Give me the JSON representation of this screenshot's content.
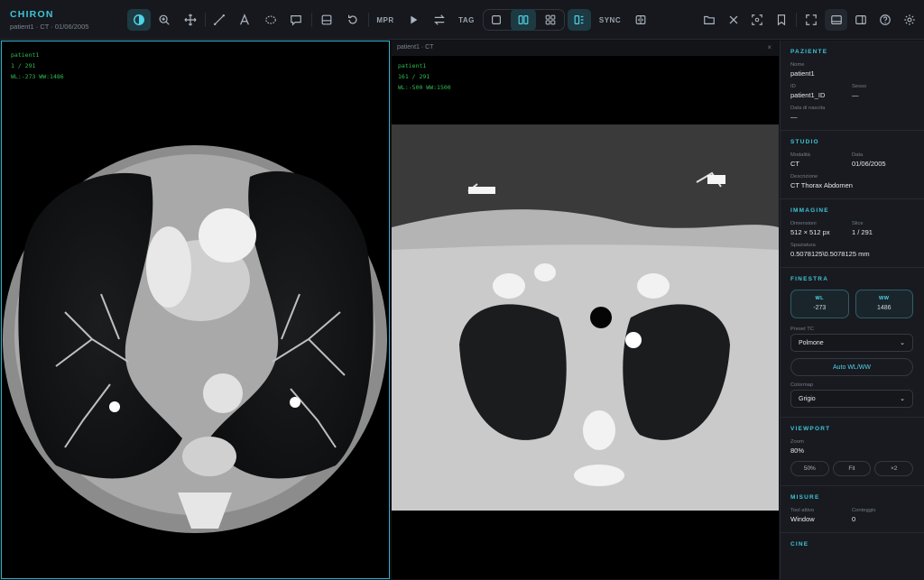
{
  "app": {
    "title": "CHIRON",
    "subtitle": "patient1 · CT · 01/06/2005"
  },
  "toolbar": {
    "mpr": "MPR",
    "tag": "TAG",
    "sync": "SYNC"
  },
  "viewports": {
    "left": {
      "line1": "patient1",
      "line2": "1 / 291",
      "line3": "WL:-273 WW:1486"
    },
    "right": {
      "header": "patient1 · CT",
      "close": "×",
      "line1": "patient1",
      "line2": "161 / 291",
      "line3": "WL:-500 WW:1500"
    }
  },
  "panel": {
    "patient": {
      "title": "PAZIENTE",
      "name_label": "Nome",
      "name": "patient1",
      "id_label": "ID",
      "id": "patient1_ID",
      "sex_label": "Sesso",
      "sex": "—",
      "dob_label": "Data di nascita",
      "dob": "—"
    },
    "study": {
      "title": "STUDIO",
      "modality_label": "Modalità",
      "modality": "CT",
      "date_label": "Data",
      "date": "01/06/2005",
      "desc_label": "Descrizione",
      "desc": "CT Thorax Abdomen"
    },
    "image": {
      "title": "IMMAGINE",
      "dim_label": "Dimensioni",
      "dim": "512 × 512 px",
      "slice_label": "Slice",
      "slice": "1 / 291",
      "spacing_label": "Spaziatura",
      "spacing": "0.5078125\\0.5078125 mm"
    },
    "window": {
      "title": "FINESTRA",
      "wl_label": "WL",
      "wl": "-273",
      "ww_label": "WW",
      "ww": "1486",
      "preset_label": "Preset TC",
      "preset": "Polmone",
      "auto": "Auto WL/WW",
      "colormap_label": "Colormap",
      "colormap": "Grigio"
    },
    "viewport": {
      "title": "VIEWPORT",
      "zoom_label": "Zoom",
      "zoom": "80%",
      "b1": "50%",
      "b2": "Fit",
      "b3": "×2"
    },
    "measures": {
      "title": "MISURE",
      "tool_label": "Tool attivo",
      "tool": "Window",
      "count_label": "Conteggio",
      "count": "0"
    },
    "next": {
      "title": "CINE"
    }
  }
}
